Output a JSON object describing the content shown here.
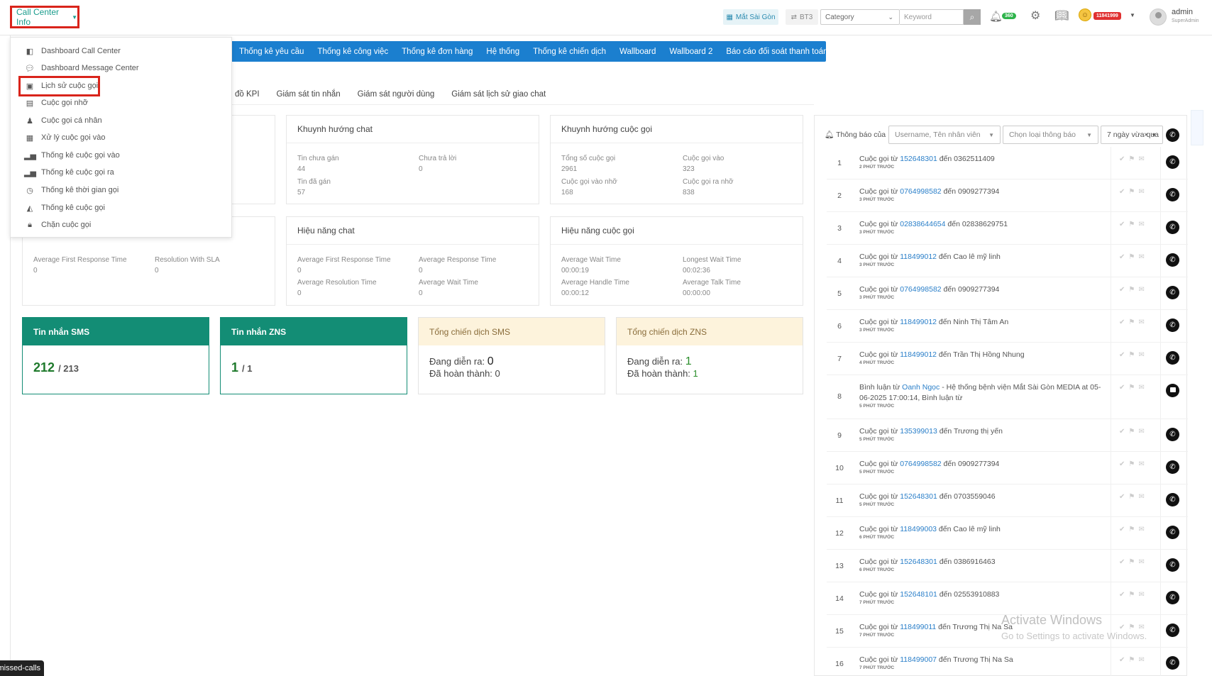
{
  "header": {
    "menu_label": "Call Center Info",
    "branch": "Mắt Sài Gòn",
    "bt3": "BT3",
    "category": "Category",
    "keyword_placeholder": "Keyword",
    "bell_count": "360",
    "red_badge": "11841999",
    "user_name": "admin",
    "user_role": "SuperAdmin"
  },
  "dropdown": {
    "items": [
      {
        "label": "Dashboard Call Center",
        "icon": "dashboard-icon"
      },
      {
        "label": "Dashboard Message Center",
        "icon": "message-icon"
      },
      {
        "label": "Lịch sử cuộc gọi",
        "icon": "calendar-icon"
      },
      {
        "label": "Cuộc gọi nhỡ",
        "icon": "calendar-icon"
      },
      {
        "label": "Cuộc gọi cá nhân",
        "icon": "user-icon"
      },
      {
        "label": "Xử lý cuộc gọi vào",
        "icon": "list-icon"
      },
      {
        "label": "Thống kê cuộc gọi vào",
        "icon": "chart-icon"
      },
      {
        "label": "Thống kê cuộc gọi ra",
        "icon": "chart-icon"
      },
      {
        "label": "Thống kê thời gian gọi",
        "icon": "clock-icon"
      },
      {
        "label": "Thống kê cuộc gọi",
        "icon": "area-chart-icon"
      },
      {
        "label": "Chặn cuộc gọi",
        "icon": "lock-icon"
      }
    ]
  },
  "nav": {
    "items": [
      "Thống kê yêu cầu",
      "Thống kê công việc",
      "Thống kê đơn hàng",
      "Hệ thống",
      "Thống kê chiến dịch",
      "Wallboard",
      "Wallboard 2",
      "Báo cáo đối soát thanh toán online"
    ]
  },
  "subtabs": {
    "items": [
      "đồ KPI",
      "Giám sát tin nhắn",
      "Giám sát người dùng",
      "Giám sát lịch sử giao chat"
    ]
  },
  "cards": {
    "chat_trend": {
      "title": "Khuynh hướng chat",
      "unassigned_label": "Tin chưa gán",
      "unassigned": "44",
      "no_reply_label": "Chưa trả lời",
      "no_reply": "0",
      "assigned_label": "Tin đã gán",
      "assigned": "57"
    },
    "call_trend": {
      "title": "Khuynh hướng cuộc gọi",
      "total_label": "Tổng số cuộc gọi",
      "total": "2961",
      "in_label": "Cuộc gọi vào",
      "in": "323",
      "missed_in_label": "Cuộc gọi vào nhỡ",
      "missed_in": "168",
      "missed_out_label": "Cuộc gọi ra nhỡ",
      "missed_out": "838"
    },
    "perf_left": {
      "afrt_label": "Average First Response Time",
      "afrt": "0",
      "rws_label": "Resolution With SLA",
      "rws": "0"
    },
    "chat_perf": {
      "title": "Hiệu năng chat",
      "afrt_label": "Average First Response Time",
      "afrt": "0",
      "art_label": "Average Response Time",
      "art": "0",
      "arest_label": "Average Resolution Time",
      "arest": "0",
      "awt_label": "Average Wait Time",
      "awt": "0"
    },
    "call_perf": {
      "title": "Hiệu năng cuộc gọi",
      "awt_label": "Average Wait Time",
      "awt": "00:00:19",
      "lwt_label": "Longest Wait Time",
      "lwt": "00:02:36",
      "aht_label": "Average Handle Time",
      "aht": "00:00:12",
      "att_label": "Average Talk Time",
      "att": "00:00:00"
    },
    "sms": {
      "title": "Tin nhắn SMS",
      "value": "212",
      "total": "/ 213"
    },
    "zns": {
      "title": "Tin nhắn ZNS",
      "value": "1",
      "total": "/ 1"
    },
    "sms_campaign": {
      "title": "Tổng chiến dịch SMS",
      "running_label": "Đang diễn ra:",
      "running": "0",
      "done_label": "Đã hoàn thành:",
      "done": "0"
    },
    "zns_campaign": {
      "title": "Tổng chiến dịch ZNS",
      "running_label": "Đang diễn ra:",
      "running": "1",
      "done_label": "Đã hoàn thành:",
      "done": "1"
    }
  },
  "notifications": {
    "label": "Thông báo của",
    "user_placeholder": "Username, Tên nhân viên",
    "type_placeholder": "Chọn loại thông báo",
    "range": "7 ngày vừa qua",
    "rows": [
      {
        "num": "1",
        "pre": "Cuộc gọi từ ",
        "link": "152648301",
        "post": " đến 0362511409",
        "time": "2 PHÚT TRƯỚC"
      },
      {
        "num": "2",
        "pre": "Cuộc gọi từ ",
        "link": "0764998582",
        "post": " đến 0909277394",
        "time": "3 PHÚT TRƯỚC"
      },
      {
        "num": "3",
        "pre": "Cuộc gọi từ ",
        "link": "02838644654",
        "post": " đến 02838629751",
        "time": "3 PHÚT TRƯỚC"
      },
      {
        "num": "4",
        "pre": "Cuộc gọi từ ",
        "link": "118499012",
        "post": " đến Cao lê mỹ linh",
        "time": "3 PHÚT TRƯỚC"
      },
      {
        "num": "5",
        "pre": "Cuộc gọi từ ",
        "link": "0764998582",
        "post": " đến 0909277394",
        "time": "3 PHÚT TRƯỚC"
      },
      {
        "num": "6",
        "pre": "Cuộc gọi từ ",
        "link": "118499012",
        "post": " đến Ninh Thị Tâm An",
        "time": "3 PHÚT TRƯỚC"
      },
      {
        "num": "7",
        "pre": "Cuộc gọi từ ",
        "link": "118499012",
        "post": " đến Trần Thị Hồng Nhung",
        "time": "4 PHÚT TRƯỚC"
      },
      {
        "num": "8",
        "pre": "Bình luận từ ",
        "link": "Oanh Ngọc",
        "post": " - Hệ thống bệnh viện Mắt Sài Gòn MEDIA at 05-06-2025 17:00:14, Bình luận từ",
        "time": "5 PHÚT TRƯỚC",
        "type": "msg"
      },
      {
        "num": "9",
        "pre": "Cuộc gọi từ ",
        "link": "135399013",
        "post": " đến Trương thị yến",
        "time": "5 PHÚT TRƯỚC"
      },
      {
        "num": "10",
        "pre": "Cuộc gọi từ ",
        "link": "0764998582",
        "post": " đến 0909277394",
        "time": "5 PHÚT TRƯỚC"
      },
      {
        "num": "11",
        "pre": "Cuộc gọi từ ",
        "link": "152648301",
        "post": " đến 0703559046",
        "time": "5 PHÚT TRƯỚC"
      },
      {
        "num": "12",
        "pre": "Cuộc gọi từ ",
        "link": "118499003",
        "post": " đến Cao lê mỹ linh",
        "time": "6 PHÚT TRƯỚC"
      },
      {
        "num": "13",
        "pre": "Cuộc gọi từ ",
        "link": "152648301",
        "post": " đến 0386916463",
        "time": "6 PHÚT TRƯỚC"
      },
      {
        "num": "14",
        "pre": "Cuộc gọi từ ",
        "link": "152648101",
        "post": " đến 02553910883",
        "time": "7 PHÚT TRƯỚC"
      },
      {
        "num": "15",
        "pre": "Cuộc gọi từ ",
        "link": "118499011",
        "post": " đến Trương Thị Na Sa",
        "time": "7 PHÚT TRƯỚC"
      },
      {
        "num": "16",
        "pre": "Cuộc gọi từ ",
        "link": "118499007",
        "post": " đến Trương Thị Na Sa",
        "time": "7 PHÚT TRƯỚC"
      }
    ]
  },
  "watermark": {
    "line1": "Activate Windows",
    "line2": "Go to Settings to activate Windows."
  },
  "tooltip": "missed-calls"
}
